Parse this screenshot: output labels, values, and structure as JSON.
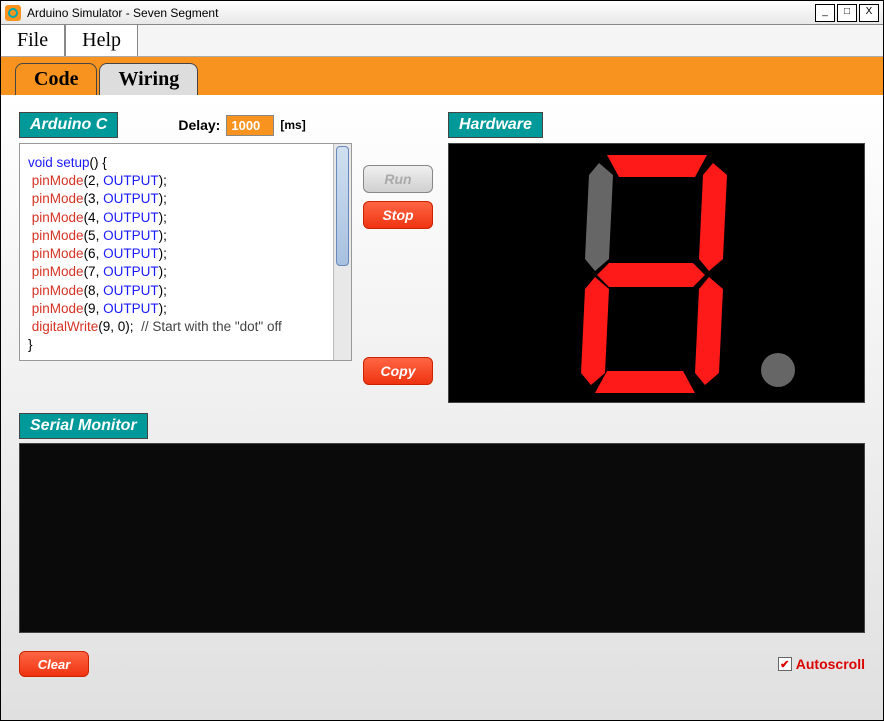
{
  "window": {
    "title": "Arduino Simulator - Seven Segment"
  },
  "menubar": {
    "file": "File",
    "help": "Help"
  },
  "tabs": {
    "code": "Code",
    "wiring": "Wiring"
  },
  "panels": {
    "arduino_c": "Arduino C",
    "hardware": "Hardware",
    "serial": "Serial Monitor"
  },
  "delay": {
    "label": "Delay:",
    "value": "1000",
    "unit": "[ms]"
  },
  "buttons": {
    "run": "Run",
    "stop": "Stop",
    "copy": "Copy",
    "clear": "Clear"
  },
  "autoscroll": {
    "label": "Autoscroll",
    "checked": true
  },
  "code": {
    "l1a": "void setup",
    "l1b": "() {",
    "pm": "pinMode",
    "out": "OUTPUT",
    "p2": "(2, ",
    "p3": "(3, ",
    "p4": "(4, ",
    "p5": "(5, ",
    "p6": "(6, ",
    "p7": "(7, ",
    "p8": "(8, ",
    "p9": "(9, ",
    "close": ");",
    "dw": "digitalWrite",
    "dwargs": "(9, 0);  ",
    "comment": "// Start with the \"dot\" off",
    "end": "}"
  },
  "segments": {
    "a": {
      "on": true
    },
    "b": {
      "on": true
    },
    "c": {
      "on": true
    },
    "d": {
      "on": true
    },
    "e": {
      "on": true
    },
    "f": {
      "on": false
    },
    "g": {
      "on": true
    },
    "dp": {
      "on": false
    }
  },
  "colors": {
    "seg_on": "#ff1a1a",
    "seg_off": "#666666",
    "accent": "#f7931e",
    "teal": "#009999"
  }
}
